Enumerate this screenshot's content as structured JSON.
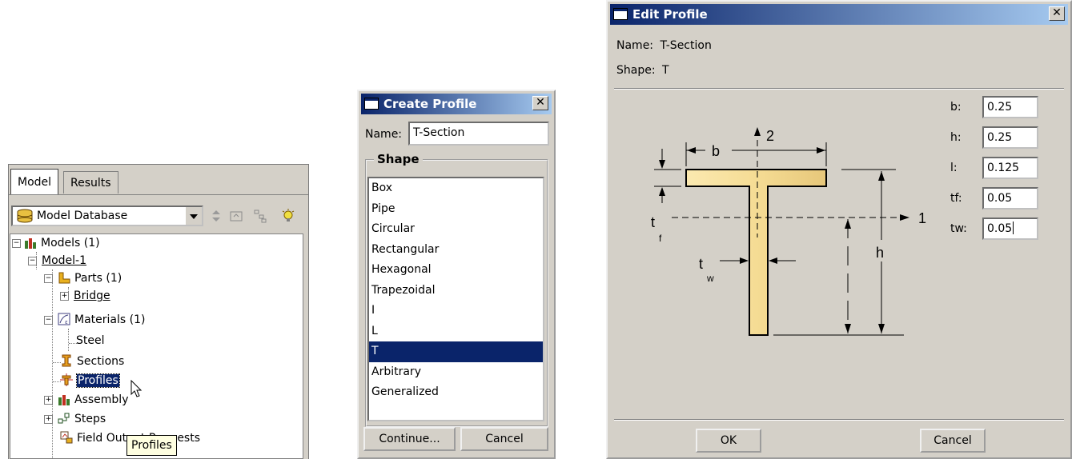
{
  "tree_panel": {
    "tabs": [
      {
        "label": "Model"
      },
      {
        "label": "Results"
      }
    ],
    "database_label": "Model Database",
    "nodes": {
      "models": "Models (1)",
      "model1": "Model-1",
      "parts": "Parts (1)",
      "bridge": "Bridge",
      "materials": "Materials (1)",
      "steel": "Steel",
      "sections": "Sections",
      "profiles": "Profiles",
      "assembly": "Assembly",
      "steps": "Steps",
      "field_output": "Field Output Requests"
    },
    "tooltip": "Profiles"
  },
  "create_profile": {
    "title": "Create Profile",
    "name_label": "Name:",
    "name_value": "T-Section",
    "shape_group_label": "Shape",
    "shapes": [
      {
        "label": "Box"
      },
      {
        "label": "Pipe"
      },
      {
        "label": "Circular"
      },
      {
        "label": "Rectangular"
      },
      {
        "label": "Hexagonal"
      },
      {
        "label": "Trapezoidal"
      },
      {
        "label": "I"
      },
      {
        "label": "L"
      },
      {
        "label": "T"
      },
      {
        "label": "Arbitrary"
      },
      {
        "label": "Generalized"
      }
    ],
    "selected_shape": "T",
    "continue_label": "Continue...",
    "cancel_label": "Cancel"
  },
  "edit_profile": {
    "title": "Edit Profile",
    "name_label": "Name:",
    "name_value": "T-Section",
    "shape_label": "Shape:",
    "shape_value": "T",
    "params": [
      {
        "label": "b:",
        "value": "0.25"
      },
      {
        "label": "h:",
        "value": "0.25"
      },
      {
        "label": "l:",
        "value": "0.125"
      },
      {
        "label": "tf:",
        "value": "0.05"
      },
      {
        "label": "tw:",
        "value": "0.05"
      }
    ],
    "diagram": {
      "b": "b",
      "h": "h",
      "tf_main": "t",
      "tf_sub": "f",
      "tw_main": "t",
      "tw_sub": "w",
      "axis1": "1",
      "axis2": "2"
    },
    "ok_label": "OK",
    "cancel_label": "Cancel",
    "colors": {
      "section_fill": "#f5dc94",
      "section_stroke": "#000000"
    }
  }
}
